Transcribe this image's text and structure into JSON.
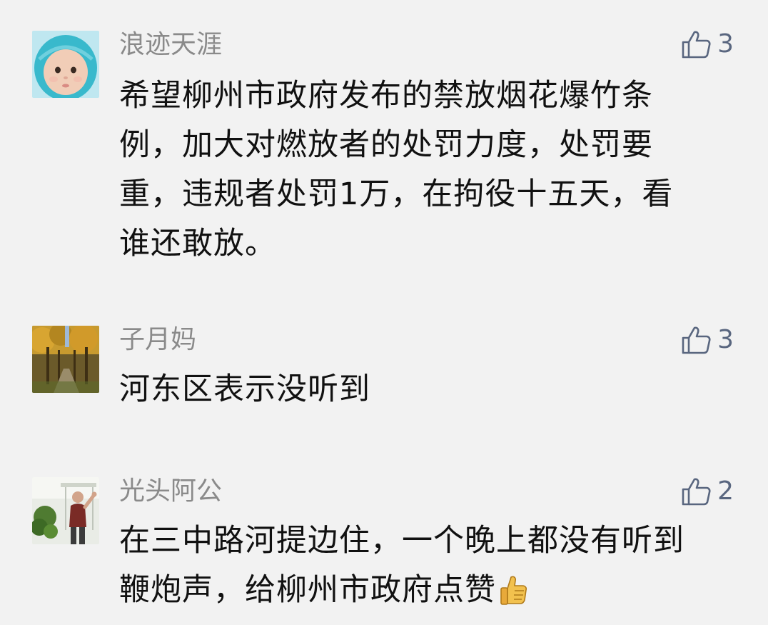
{
  "comments": [
    {
      "username": "浪迹天涯",
      "likes": "3",
      "avatar": "baby-avatar",
      "lines": [
        "希望柳州市政府发布的禁放烟花爆竹条",
        "例，加大对燃放者的处罚力度，处罚要",
        "重，违规者处罚1万，在拘役十五天，看",
        "谁还敢放。"
      ]
    },
    {
      "username": "子月妈",
      "likes": "3",
      "avatar": "autumn-trees-avatar",
      "lines": [
        "河东区表示没听到"
      ]
    },
    {
      "username": "光头阿公",
      "likes": "2",
      "avatar": "man-waving-avatar",
      "lines": [
        "在三中路河提边住，一个晚上都没有听到",
        "鞭炮声，给柳州市政府点赞"
      ],
      "trailing_emoji": "thumbs-up-emoji"
    }
  ],
  "colors": {
    "background": "#f2f2f2",
    "username": "#8a8a8a",
    "like": "#59667f",
    "text": "#111111"
  }
}
